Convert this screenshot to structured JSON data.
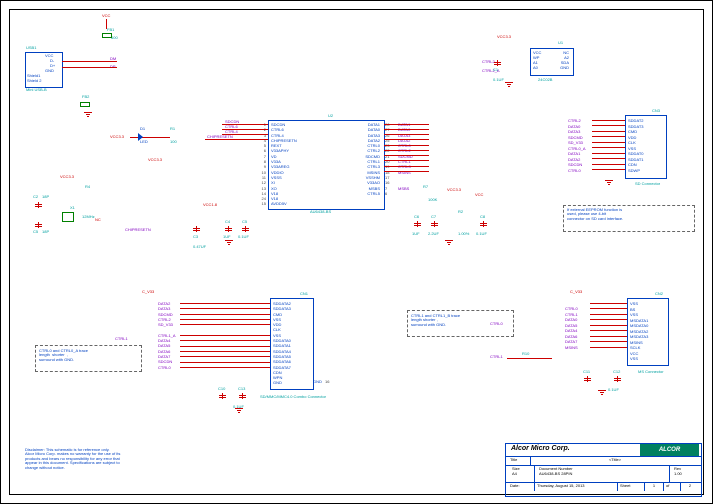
{
  "power": {
    "vcc": "VCC",
    "vcc33": "VCC3.3",
    "vcc18": "VCC1.8",
    "cv33": "C_V33",
    "nc": "NC"
  },
  "usb": {
    "title": "USB1",
    "pins": [
      "VCC",
      "D-",
      "D+",
      "GND",
      "Shield1",
      "Shield 2"
    ],
    "type": "Mini USB-B",
    "fb1": "FB1",
    "fb2": "FB2",
    "fbval": "600",
    "dm": "DM",
    "dp": "DP"
  },
  "xtal": {
    "c2": "C2",
    "c2v": "18P",
    "c5": "C5",
    "c5v": "18P",
    "x1": "X1",
    "freq": "12MHz",
    "r4": "R4",
    "r4v": "NC",
    "sig": "CHIPRESETN"
  },
  "led": {
    "d1": "D1",
    "led": "LED",
    "r1": "R1",
    "r1v": "100",
    "sig": "CHIPRESETN"
  },
  "u2": {
    "name": "U2",
    "part": "AU6438-BS",
    "left": [
      "SDCDN",
      "CTRL6",
      "CTRL4",
      "CHIPRESETN",
      "REXT",
      "V33APHY",
      "VD",
      "V33A",
      "V33AREG",
      "VDDIO",
      "VSSS",
      "XI",
      "XO",
      "V18",
      "V18",
      "AVDD5V"
    ],
    "lpin": [
      "1",
      "2",
      "3",
      "4",
      "5",
      "6",
      "7",
      "8",
      "9",
      "10",
      "11",
      "12",
      "13",
      "14",
      "24",
      "15"
    ],
    "right": [
      "DATA1",
      "DATA0",
      "DATA3",
      "DATA2",
      "CTRL0",
      "CTRL2",
      "SDCMD",
      "CTRL1",
      "CTRL3",
      "MSINS",
      "VSSHM",
      "V33AO",
      "MSBS",
      "CTRL5"
    ],
    "rpin": [
      "28",
      "27",
      "26",
      "25",
      "23",
      "22",
      "21",
      "20",
      "19",
      "18",
      "17",
      "16",
      "7",
      "6"
    ],
    "rsig": [
      "DATA1",
      "DATA0",
      "DATA3",
      "DATA2",
      "CTRL0",
      "CTRL2",
      "SDCMD",
      "CTRL1",
      "CTRL3",
      "MSINS",
      "",
      "",
      "MSBS",
      ""
    ]
  },
  "r7": {
    "ref": "R7",
    "val": "100K"
  },
  "caps_l": {
    "c3": "C3",
    "c3v": "0.47UF",
    "c4": "C4",
    "c4v": "1UF",
    "c5": "C5",
    "c5v": "0.1UF"
  },
  "caps_r": {
    "c6": "C6",
    "c6v": "1UF",
    "c7": "C7",
    "c7v": "2.2UF",
    "c8": "C8",
    "c8v": "0.1UF",
    "r2": "R2",
    "r2v": "1.00%"
  },
  "cn1": {
    "title": "CN1",
    "type": "SD/MMC/MMC4.0 Combo Connector",
    "sigL": [
      "DATA2",
      "DATA3",
      "SDCMD",
      "CTRL2",
      "SD_V33",
      "CTRL1_A",
      "DATA4",
      "DATA5",
      "DATA6",
      "DATA7",
      "SDCDN",
      "CTRL0"
    ],
    "pins": [
      "SDDATA2",
      "SDDATA3",
      "CMD",
      "VSS",
      "VDD",
      "CLK",
      "VSS",
      "SDDATA0",
      "SDDATA1",
      "SDDATA4",
      "SDDATA5",
      "SDDATA6",
      "SDDATA7",
      "CDN",
      "WPN",
      "GND"
    ],
    "cap": {
      "c10": "C10",
      "c13": "C13",
      "c13v": "0.1UF",
      "gndpin": "16"
    }
  },
  "cn2": {
    "title": "CN2",
    "type": "MS Connector",
    "sigL": [
      "CTRL0",
      "CTRL1",
      "DATA0",
      "DATA5",
      "DATA4",
      "DATA6",
      "DATA7",
      "MSINS"
    ],
    "pins": [
      "VSS",
      "BS",
      "VSS",
      "MSDATA1",
      "MSDATA0",
      "MSDATA2",
      "MSDATA3",
      "MSINS",
      "SCLK",
      "VCC",
      "VSS"
    ],
    "r10": "R10",
    "c11": "C11",
    "c12": "C12",
    "c12v": "0.1UF"
  },
  "cn3": {
    "title": "CN3",
    "type": "SD Connector",
    "sigL": [
      "CTRL2",
      "DATA0",
      "DATA3",
      "SDCMD",
      "SD_V33",
      "CTRL0_A",
      "DATA1",
      "DATA2",
      "SDCDN",
      "CTRL0"
    ],
    "pins": [
      "SDDAT2",
      "SDDAT3",
      "CMD",
      "VDD",
      "CLK",
      "VSS",
      "SDDAT0",
      "SDDAT1",
      "CDN",
      "SDWP"
    ]
  },
  "u1": {
    "title": "U1",
    "pins": [
      "VCC",
      "WP",
      "A1",
      "A0",
      "NC",
      "A2",
      "SDA",
      "GND"
    ],
    "part": "24C02B",
    "c1": "C1",
    "c1v": "0.1UF",
    "sig": [
      "CTRL2",
      "CTRL2_A"
    ]
  },
  "notes": {
    "sd_note": "If external EEPROM function is\nused, please use 4-bit\nconnector on SD card interface.",
    "n1": "CTRL0 and CTRL0_A trace\nlength  shorter  ,\nsurround with GND.",
    "n2": "CTRL1 and CTRL1_B trace\nlength shorter ,\nsurround with GND.",
    "disclaimer": "Disclaimer: This schematic is for reference only.\nAlcor Micro Corp. makes no warranty for the use of its\nproducts and bears no responsibility for any error that\nappear in this document. Specifications are subject to\nchange without notice."
  },
  "titleblock": {
    "company": "Alcor Micro Corp.",
    "logo": "ALCOR",
    "title": "<Title>",
    "size": "Size",
    "sizeval": "A4",
    "docnum": "Document Number",
    "docval": "AU6438-BS 28PIN",
    "rev": "Rev",
    "revval": "1.00",
    "date": "Date:",
    "dateval": "Thursday, August 15, 2013",
    "sheet": "Sheet",
    "sheetval": "1",
    "of": "of",
    "ofval": "2"
  }
}
